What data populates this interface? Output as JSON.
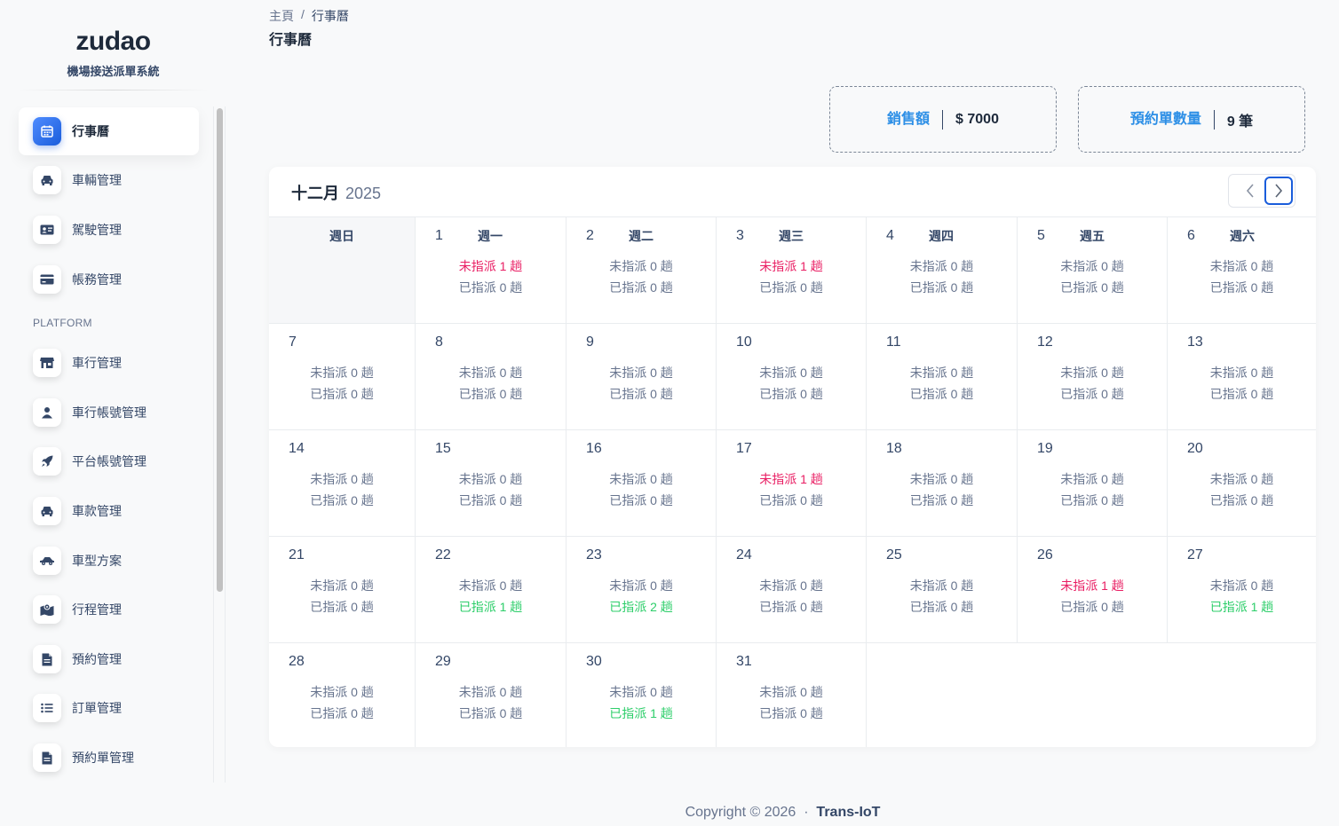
{
  "brand": {
    "logo": "zudao",
    "subtitle": "機場接送派單系統"
  },
  "sidebar": {
    "section_label": "PLATFORM",
    "items": [
      {
        "label": "行事曆",
        "icon": "calendar-icon",
        "active": true
      },
      {
        "label": "車輛管理",
        "icon": "car-icon"
      },
      {
        "label": "駕駛管理",
        "icon": "id-card-icon"
      },
      {
        "label": "帳務管理",
        "icon": "credit-card-icon"
      },
      {
        "label": "車行管理",
        "icon": "store-icon"
      },
      {
        "label": "車行帳號管理",
        "icon": "user-icon"
      },
      {
        "label": "平台帳號管理",
        "icon": "rocket-icon"
      },
      {
        "label": "車款管理",
        "icon": "car-icon"
      },
      {
        "label": "車型方案",
        "icon": "car-side-icon"
      },
      {
        "label": "行程管理",
        "icon": "map-icon"
      },
      {
        "label": "預約管理",
        "icon": "document-icon"
      },
      {
        "label": "訂單管理",
        "icon": "list-icon"
      },
      {
        "label": "預約單管理",
        "icon": "document-icon"
      }
    ]
  },
  "breadcrumb": {
    "home": "主頁",
    "separator": "/",
    "current": "行事曆"
  },
  "page_title": "行事曆",
  "stats": {
    "sales": {
      "label": "銷售額",
      "value": "$ 7000"
    },
    "bookings": {
      "label": "預約單數量",
      "value": "9 筆"
    }
  },
  "calendar": {
    "month": "十二月",
    "year": "2025",
    "weekdays": [
      "週日",
      "週一",
      "週二",
      "週三",
      "週四",
      "週五",
      "週六"
    ],
    "unassigned_prefix": "未指派",
    "assigned_prefix": "已指派",
    "unit": "趟",
    "days": [
      {
        "day": "1",
        "u": 1,
        "a": 0
      },
      {
        "day": "2",
        "u": 0,
        "a": 0
      },
      {
        "day": "3",
        "u": 1,
        "a": 0
      },
      {
        "day": "4",
        "u": 0,
        "a": 0
      },
      {
        "day": "5",
        "u": 0,
        "a": 0
      },
      {
        "day": "6",
        "u": 0,
        "a": 0
      },
      {
        "day": "7",
        "u": 0,
        "a": 0
      },
      {
        "day": "8",
        "u": 0,
        "a": 0
      },
      {
        "day": "9",
        "u": 0,
        "a": 0
      },
      {
        "day": "10",
        "u": 0,
        "a": 0
      },
      {
        "day": "11",
        "u": 0,
        "a": 0
      },
      {
        "day": "12",
        "u": 0,
        "a": 0
      },
      {
        "day": "13",
        "u": 0,
        "a": 0
      },
      {
        "day": "14",
        "u": 0,
        "a": 0
      },
      {
        "day": "15",
        "u": 0,
        "a": 0
      },
      {
        "day": "16",
        "u": 0,
        "a": 0
      },
      {
        "day": "17",
        "u": 1,
        "a": 0
      },
      {
        "day": "18",
        "u": 0,
        "a": 0
      },
      {
        "day": "19",
        "u": 0,
        "a": 0
      },
      {
        "day": "20",
        "u": 0,
        "a": 0
      },
      {
        "day": "21",
        "u": 0,
        "a": 0
      },
      {
        "day": "22",
        "u": 0,
        "a": 1
      },
      {
        "day": "23",
        "u": 0,
        "a": 2
      },
      {
        "day": "24",
        "u": 0,
        "a": 0
      },
      {
        "day": "25",
        "u": 0,
        "a": 0
      },
      {
        "day": "26",
        "u": 1,
        "a": 0
      },
      {
        "day": "27",
        "u": 0,
        "a": 1
      },
      {
        "day": "28",
        "u": 0,
        "a": 0
      },
      {
        "day": "29",
        "u": 0,
        "a": 0
      },
      {
        "day": "30",
        "u": 0,
        "a": 1
      },
      {
        "day": "31",
        "u": 0,
        "a": 0
      }
    ]
  },
  "footer": {
    "copyright": "Copyright © 2026",
    "dot": "·",
    "brand": "Trans-IoT"
  },
  "colors": {
    "accent": "#1a5ddb",
    "stat_label": "#2d8fe6",
    "unassigned_alert": "#e91e63",
    "assigned_ok": "#2dce6a"
  }
}
